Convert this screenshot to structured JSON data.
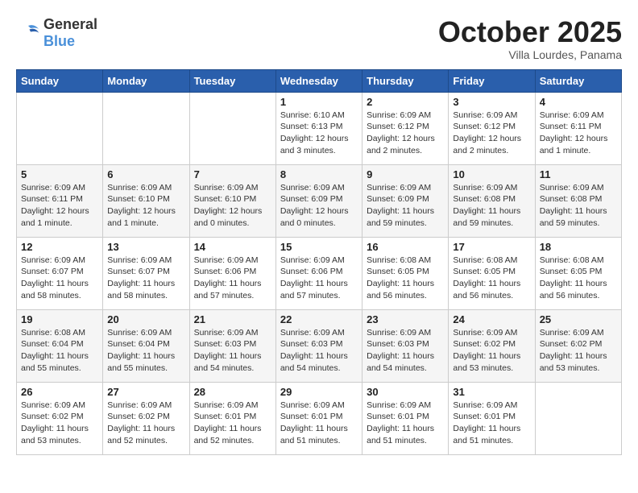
{
  "header": {
    "logo_general": "General",
    "logo_blue": "Blue",
    "month": "October 2025",
    "location": "Villa Lourdes, Panama"
  },
  "weekdays": [
    "Sunday",
    "Monday",
    "Tuesday",
    "Wednesday",
    "Thursday",
    "Friday",
    "Saturday"
  ],
  "weeks": [
    [
      {
        "day": "",
        "info": ""
      },
      {
        "day": "",
        "info": ""
      },
      {
        "day": "",
        "info": ""
      },
      {
        "day": "1",
        "info": "Sunrise: 6:10 AM\nSunset: 6:13 PM\nDaylight: 12 hours\nand 3 minutes."
      },
      {
        "day": "2",
        "info": "Sunrise: 6:09 AM\nSunset: 6:12 PM\nDaylight: 12 hours\nand 2 minutes."
      },
      {
        "day": "3",
        "info": "Sunrise: 6:09 AM\nSunset: 6:12 PM\nDaylight: 12 hours\nand 2 minutes."
      },
      {
        "day": "4",
        "info": "Sunrise: 6:09 AM\nSunset: 6:11 PM\nDaylight: 12 hours\nand 1 minute."
      }
    ],
    [
      {
        "day": "5",
        "info": "Sunrise: 6:09 AM\nSunset: 6:11 PM\nDaylight: 12 hours\nand 1 minute."
      },
      {
        "day": "6",
        "info": "Sunrise: 6:09 AM\nSunset: 6:10 PM\nDaylight: 12 hours\nand 1 minute."
      },
      {
        "day": "7",
        "info": "Sunrise: 6:09 AM\nSunset: 6:10 PM\nDaylight: 12 hours\nand 0 minutes."
      },
      {
        "day": "8",
        "info": "Sunrise: 6:09 AM\nSunset: 6:09 PM\nDaylight: 12 hours\nand 0 minutes."
      },
      {
        "day": "9",
        "info": "Sunrise: 6:09 AM\nSunset: 6:09 PM\nDaylight: 11 hours\nand 59 minutes."
      },
      {
        "day": "10",
        "info": "Sunrise: 6:09 AM\nSunset: 6:08 PM\nDaylight: 11 hours\nand 59 minutes."
      },
      {
        "day": "11",
        "info": "Sunrise: 6:09 AM\nSunset: 6:08 PM\nDaylight: 11 hours\nand 59 minutes."
      }
    ],
    [
      {
        "day": "12",
        "info": "Sunrise: 6:09 AM\nSunset: 6:07 PM\nDaylight: 11 hours\nand 58 minutes."
      },
      {
        "day": "13",
        "info": "Sunrise: 6:09 AM\nSunset: 6:07 PM\nDaylight: 11 hours\nand 58 minutes."
      },
      {
        "day": "14",
        "info": "Sunrise: 6:09 AM\nSunset: 6:06 PM\nDaylight: 11 hours\nand 57 minutes."
      },
      {
        "day": "15",
        "info": "Sunrise: 6:09 AM\nSunset: 6:06 PM\nDaylight: 11 hours\nand 57 minutes."
      },
      {
        "day": "16",
        "info": "Sunrise: 6:08 AM\nSunset: 6:05 PM\nDaylight: 11 hours\nand 56 minutes."
      },
      {
        "day": "17",
        "info": "Sunrise: 6:08 AM\nSunset: 6:05 PM\nDaylight: 11 hours\nand 56 minutes."
      },
      {
        "day": "18",
        "info": "Sunrise: 6:08 AM\nSunset: 6:05 PM\nDaylight: 11 hours\nand 56 minutes."
      }
    ],
    [
      {
        "day": "19",
        "info": "Sunrise: 6:08 AM\nSunset: 6:04 PM\nDaylight: 11 hours\nand 55 minutes."
      },
      {
        "day": "20",
        "info": "Sunrise: 6:09 AM\nSunset: 6:04 PM\nDaylight: 11 hours\nand 55 minutes."
      },
      {
        "day": "21",
        "info": "Sunrise: 6:09 AM\nSunset: 6:03 PM\nDaylight: 11 hours\nand 54 minutes."
      },
      {
        "day": "22",
        "info": "Sunrise: 6:09 AM\nSunset: 6:03 PM\nDaylight: 11 hours\nand 54 minutes."
      },
      {
        "day": "23",
        "info": "Sunrise: 6:09 AM\nSunset: 6:03 PM\nDaylight: 11 hours\nand 54 minutes."
      },
      {
        "day": "24",
        "info": "Sunrise: 6:09 AM\nSunset: 6:02 PM\nDaylight: 11 hours\nand 53 minutes."
      },
      {
        "day": "25",
        "info": "Sunrise: 6:09 AM\nSunset: 6:02 PM\nDaylight: 11 hours\nand 53 minutes."
      }
    ],
    [
      {
        "day": "26",
        "info": "Sunrise: 6:09 AM\nSunset: 6:02 PM\nDaylight: 11 hours\nand 53 minutes."
      },
      {
        "day": "27",
        "info": "Sunrise: 6:09 AM\nSunset: 6:02 PM\nDaylight: 11 hours\nand 52 minutes."
      },
      {
        "day": "28",
        "info": "Sunrise: 6:09 AM\nSunset: 6:01 PM\nDaylight: 11 hours\nand 52 minutes."
      },
      {
        "day": "29",
        "info": "Sunrise: 6:09 AM\nSunset: 6:01 PM\nDaylight: 11 hours\nand 51 minutes."
      },
      {
        "day": "30",
        "info": "Sunrise: 6:09 AM\nSunset: 6:01 PM\nDaylight: 11 hours\nand 51 minutes."
      },
      {
        "day": "31",
        "info": "Sunrise: 6:09 AM\nSunset: 6:01 PM\nDaylight: 11 hours\nand 51 minutes."
      },
      {
        "day": "",
        "info": ""
      }
    ]
  ]
}
